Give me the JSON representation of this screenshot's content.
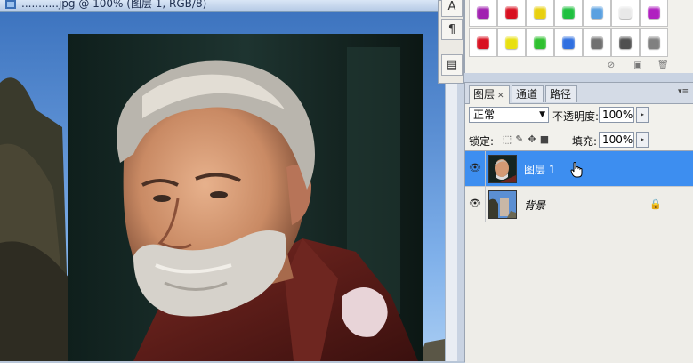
{
  "document": {
    "title": "...........jpg @ 100% (图层 1, RGB/8)"
  },
  "colors": {
    "selection": "#3d8ef0",
    "panel_bg": "#f2f1ec",
    "sky": "#5b8fd3"
  },
  "mini_toolbar": {
    "items": [
      {
        "icon": "character-icon",
        "glyph": "A"
      },
      {
        "icon": "paragraph-icon",
        "glyph": "¶"
      },
      {
        "icon": "layer-comps-icon",
        "glyph": "▤"
      }
    ]
  },
  "styles_panel": {
    "swatch_colors": [
      "#a020b0",
      "#d81020",
      "#e8d010",
      "#20c040",
      "#5aa0e0",
      "#e8e8e8",
      "#b020c0",
      "#d81020",
      "#e8e010",
      "#30c030",
      "#3070e0",
      "#707070",
      "#505050",
      "#808080"
    ],
    "footer_icons": [
      "clear-style-icon",
      "new-style-icon",
      "delete-style-icon"
    ]
  },
  "layers_panel": {
    "tabs": [
      {
        "label": "图层",
        "active": true,
        "closable": true
      },
      {
        "label": "通道",
        "active": false
      },
      {
        "label": "路径",
        "active": false
      }
    ],
    "blend_mode": "正常",
    "opacity_label": "不透明度:",
    "opacity_value": "100%",
    "lock_label": "锁定:",
    "lock_icons": [
      "lock-transparent-icon",
      "lock-image-icon",
      "lock-position-icon",
      "lock-all-icon"
    ],
    "fill_label": "填充:",
    "fill_value": "100%",
    "layers": [
      {
        "name": "图层 1",
        "selected": true,
        "visible": true,
        "locked": false
      },
      {
        "name": "背景",
        "selected": false,
        "visible": true,
        "locked": true
      }
    ]
  }
}
